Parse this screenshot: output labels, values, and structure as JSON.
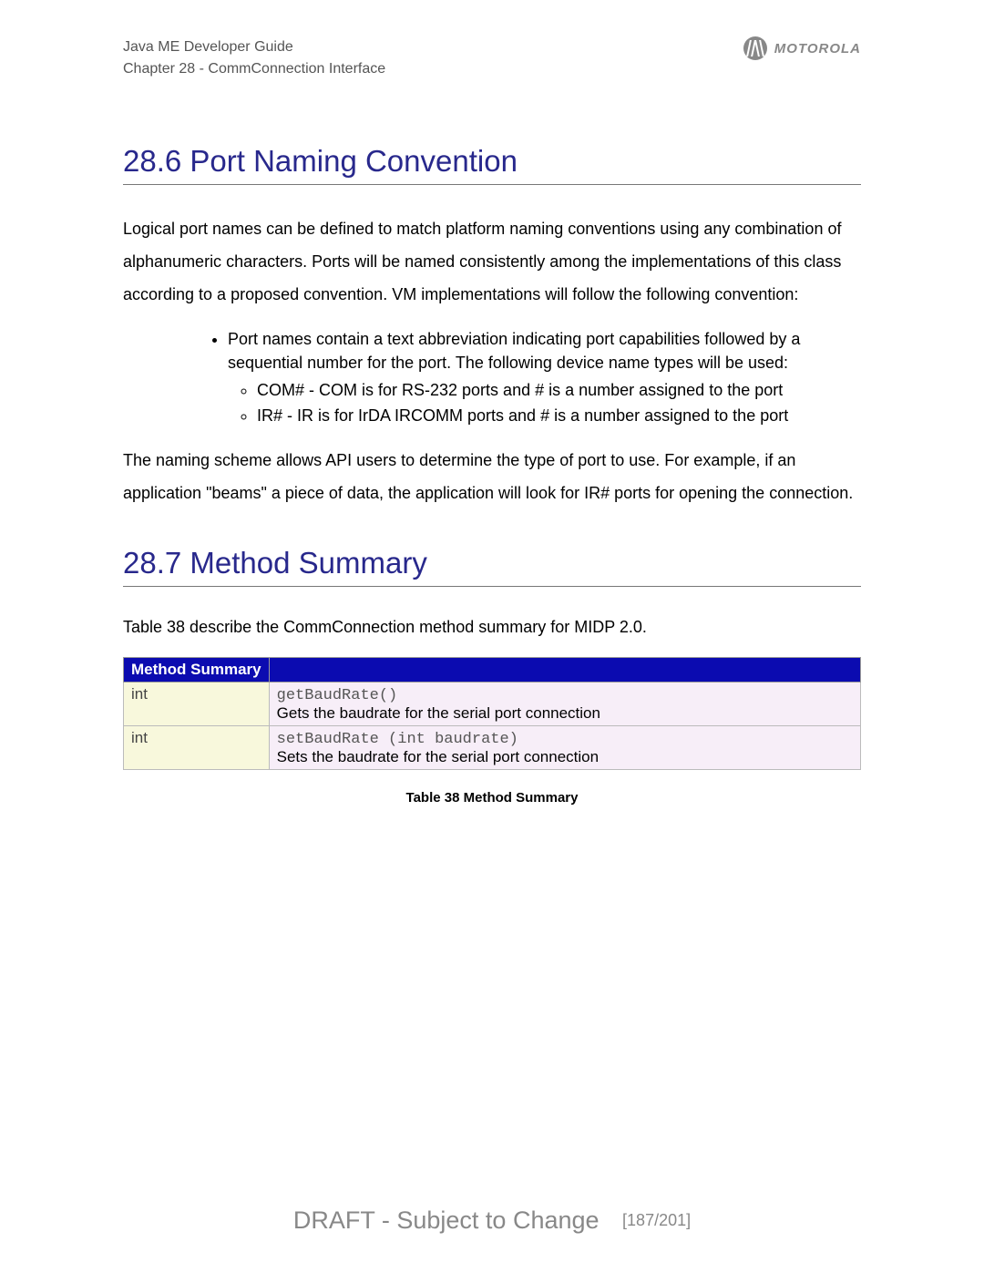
{
  "header": {
    "line1": "Java ME Developer Guide",
    "line2": "Chapter 28 - CommConnection Interface",
    "brand": "MOTOROLA"
  },
  "section1": {
    "title": "28.6 Port Naming Convention",
    "para1": "Logical port names can be defined to match platform naming conventions using any combination of alphanumeric characters. Ports will be named consistently among the implementations of this class according to a proposed convention. VM implementations will follow the following convention:",
    "bullet_main": "Port names contain a text abbreviation indicating port capabilities followed by a sequential number for the port. The following device name types will be used:",
    "sub1": "COM# - COM is for RS-232 ports and # is a number assigned to the port",
    "sub2": "IR# - IR is for IrDA IRCOMM ports and # is a number assigned to the port",
    "para2": "The naming scheme allows API users to determine the type of port to use. For example, if an application \"beams\" a piece of data, the application will look for IR# ports for opening the connection."
  },
  "section2": {
    "title": "28.7 Method Summary",
    "intro": "Table 38 describe the CommConnection method summary for MIDP 2.0.",
    "table_header": "Method Summary",
    "rows": [
      {
        "type": "int",
        "sig": "getBaudRate()",
        "desc": "Gets the baudrate for the serial port connection"
      },
      {
        "type": "int",
        "sig": "setBaudRate (int baudrate)",
        "desc": "Sets the baudrate for the serial port connection"
      }
    ],
    "caption": "Table 38 Method Summary"
  },
  "footer": {
    "status": "DRAFT - Subject to Change",
    "page": "[187/201]"
  }
}
